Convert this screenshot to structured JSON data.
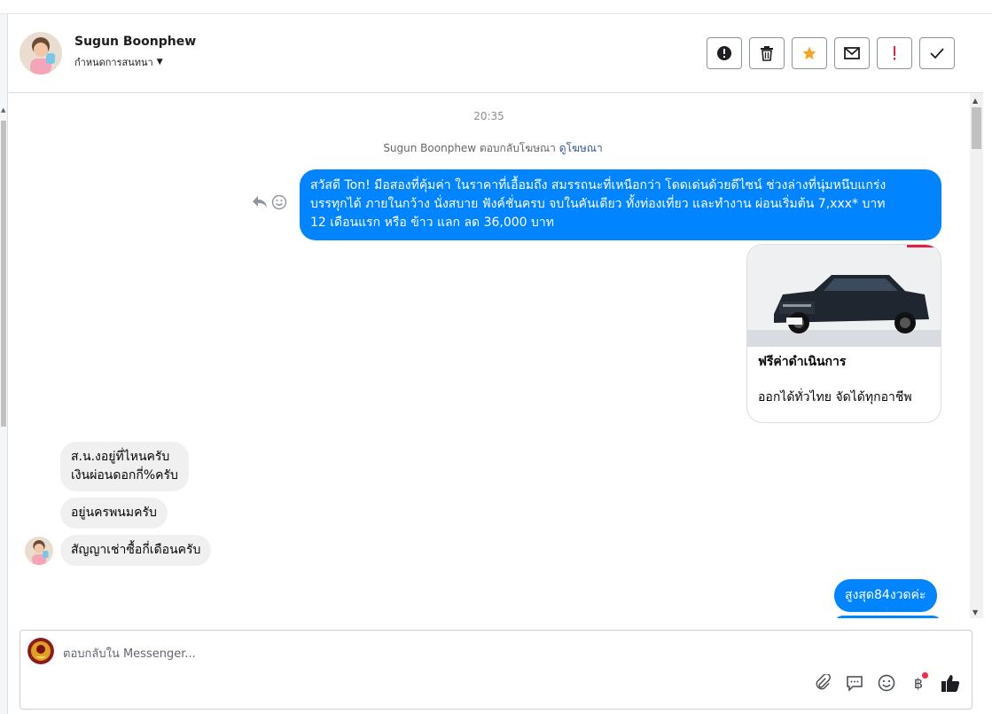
{
  "header": {
    "name": "Sugun Boonphew",
    "subtitle": "กำหนดการสนทนา",
    "actions": [
      "alert-icon",
      "trash-icon",
      "star-icon",
      "mail-icon",
      "exclamation-icon",
      "check-icon"
    ]
  },
  "conversation": {
    "timestamp": "20:35",
    "ad_reply_text": "Sugun Boonphew ตอบกลับโฆษณา",
    "ad_reply_link": "ดูโฆษณา",
    "outgoing_line1": "สวัสดี Ton! มือสองที่คุ้มค่า ในราคาที่เอื้อมถึง สมรรถนะที่เหนือกว่า โดดเด่นด้วยดีไซน์ ช่วงล่างที่นุ่มหนึบแกร่ง",
    "outgoing_line2": "บรรทุกได้ ภายในกว้าง นั่งสบาย ฟังค์ชั่นครบ จบในคันเดียว ทั้งท่องเที่ยว และทำงาน ผ่อนเริ่มต้น 7,xxx* บาท",
    "outgoing_line3": "12 เดือนแรก หรือ ข้าว แลก ลด 36,000 บาท",
    "card_title": "ฟรีค่าดำเนินการ",
    "card_subtitle": "ออกได้ทั่วไทย จัดได้ทุกอาชีพ",
    "incoming_1_line1": "ส.น.งอยู่ที่ไหนครับ",
    "incoming_1_line2": "เงินผ่อนดอกกี่%ครับ",
    "incoming_2": "อยู่นครพนมครับ",
    "incoming_3": "สัญญาเช่าซื้อกี่เดือนครับ",
    "outgoing_last": "สูงสุด84งวดค่ะ"
  },
  "composer": {
    "placeholder": "ตอบกลับใน Messenger...",
    "tools": [
      "attach-icon",
      "chat-bubble-icon",
      "emoji-icon",
      "baht-icon",
      "thumbs-up-icon"
    ]
  },
  "colors": {
    "accent": "#0084ff",
    "incoming_bubble": "#f0f0f0",
    "star": "#f5a623",
    "danger": "#e41e3f"
  }
}
